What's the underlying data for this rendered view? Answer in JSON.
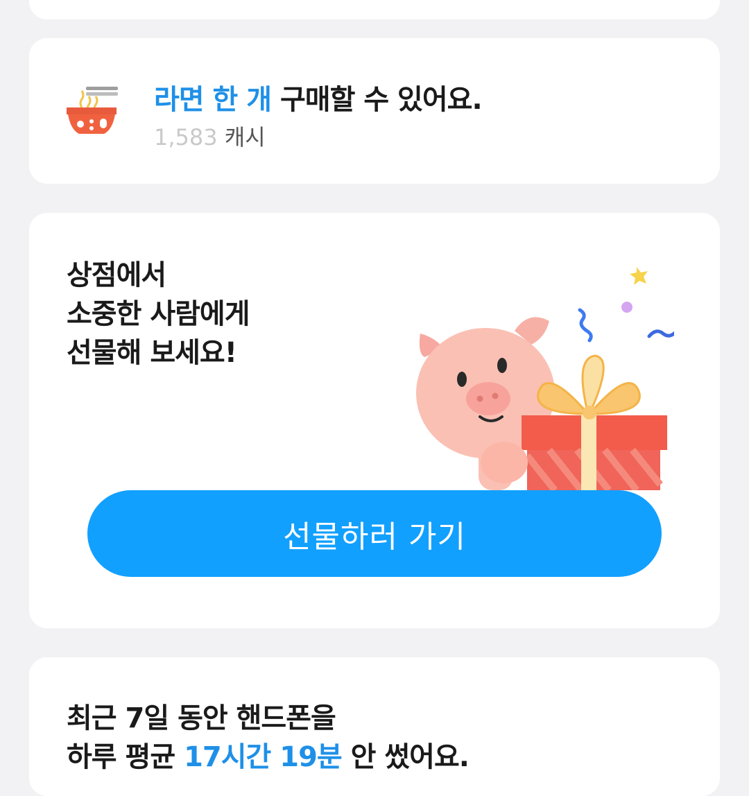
{
  "ramen_card": {
    "icon": "ramen-bowl-icon",
    "headline_highlight": "라면 한 개",
    "headline_rest": " 구매할 수 있어요.",
    "balance": "1,583",
    "balance_unit": " 캐시"
  },
  "gift_card": {
    "headline_lines": [
      "상점에서",
      "소중한 사람에게",
      "선물해 보세요!"
    ],
    "illustration": "pig-with-gift-illustration",
    "button_label": "선물하러 가기"
  },
  "usage_card": {
    "line1": "최근 7일 동안 핸드폰을",
    "line2_prefix": "하루 평균 ",
    "line2_highlight": "17시간 19분",
    "line2_suffix": " 안 썼어요."
  },
  "colors": {
    "accent": "#1e90e8",
    "button": "#12a0ff",
    "background": "#f2f2f4",
    "card": "#ffffff"
  }
}
